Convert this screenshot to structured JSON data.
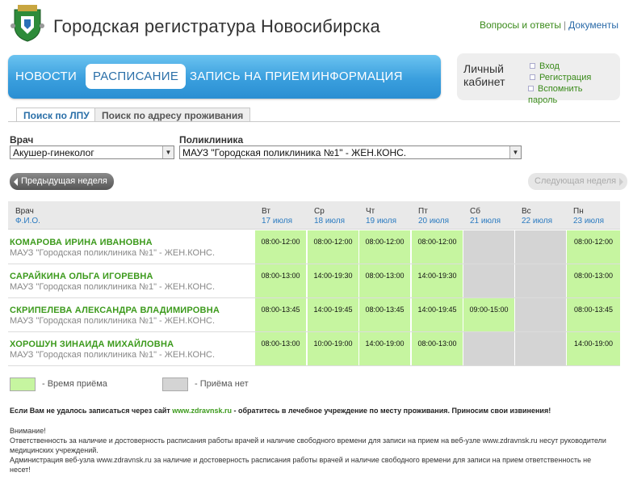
{
  "header": {
    "title": "Городская регистратура Новосибирска",
    "faq_link": "Вопросы и ответы",
    "separator": "|",
    "docs_link": "Документы"
  },
  "nav": {
    "items": [
      {
        "label": "НОВОСТИ"
      },
      {
        "label": "РАСПИСАНИЕ"
      },
      {
        "label": "ЗАПИСЬ НА ПРИЕМ"
      },
      {
        "label": "ИНФОРМАЦИЯ"
      }
    ],
    "active_index": 1
  },
  "cabinet": {
    "title": "Личный кабинет",
    "login": "Вход",
    "register": "Регистрация",
    "remember": "Вспомнить пароль"
  },
  "tabs": {
    "by_clinic": "Поиск по ЛПУ",
    "by_address": "Поиск по адресу проживания"
  },
  "filters": {
    "doctor_label": "Врач",
    "doctor_value": "Акушер-гинеколог",
    "clinic_label": "Поликлиника",
    "clinic_value": "МАУЗ \"Городская поликлиника №1\" - ЖЕН.КОНС."
  },
  "week_nav": {
    "prev": "Предыдущая неделя",
    "next": "Следующая неделя"
  },
  "table": {
    "doctor_header": "Врач",
    "doctor_subheader": "Ф.И.О.",
    "days": [
      {
        "name": "Вт",
        "date": "17 июля"
      },
      {
        "name": "Ср",
        "date": "18 июля"
      },
      {
        "name": "Чт",
        "date": "19 июля"
      },
      {
        "name": "Пт",
        "date": "20 июля"
      },
      {
        "name": "Сб",
        "date": "21 июля"
      },
      {
        "name": "Вс",
        "date": "22 июля"
      },
      {
        "name": "Пн",
        "date": "23 июля"
      }
    ],
    "rows": [
      {
        "name": "КОМАРОВА ИРИНА ИВАНОВНА",
        "place": "МАУЗ \"Городская поликлиника №1\" - ЖЕН.КОНС.",
        "slots": [
          "08:00-12:00",
          "08:00-12:00",
          "08:00-12:00",
          "08:00-12:00",
          "",
          "",
          "08:00-12:00"
        ]
      },
      {
        "name": "САРАЙКИНА ОЛЬГА ИГОРЕВНА",
        "place": "МАУЗ \"Городская поликлиника №1\" - ЖЕН.КОНС.",
        "slots": [
          "08:00-13:00",
          "14:00-19:30",
          "08:00-13:00",
          "14:00-19:30",
          "",
          "",
          "08:00-13:00"
        ]
      },
      {
        "name": "СКРИПЕЛЕВА АЛЕКСАНДРА ВЛАДИМИРОВНА",
        "place": "МАУЗ \"Городская поликлиника №1\" - ЖЕН.КОНС.",
        "slots": [
          "08:00-13:45",
          "14:00-19:45",
          "08:00-13:45",
          "14:00-19:45",
          "09:00-15:00",
          "",
          "08:00-13:45"
        ]
      },
      {
        "name": "ХОРОШУН ЗИНАИДА МИХАЙЛОВНА",
        "place": "МАУЗ \"Городская поликлиника №1\" - ЖЕН.КОНС.",
        "slots": [
          "08:00-13:00",
          "10:00-19:00",
          "14:00-19:00",
          "08:00-13:00",
          "",
          "",
          "14:00-19:00"
        ]
      }
    ]
  },
  "legend": {
    "reception": "- Время приёма",
    "no_reception": "- Приёма нет"
  },
  "notice": {
    "before": "Если Вам не удалось записаться через сайт ",
    "link": "www.zdravnsk.ru",
    "after": " - обратитесь в лечебное учреждение по месту проживания. Приносим свои извинения!"
  },
  "warning": {
    "title": "Внимание!",
    "line1": "Ответственность за наличие и достоверность расписания работы врачей и наличие свободного времени для записи на прием на веб-узле www.zdravnsk.ru несут руководители медицинских учреждений.",
    "line2": "Администрация веб-узла www.zdravnsk.ru за наличие и достоверность расписания работы врачей и наличие свободного времени для записи на прием ответственность не несет!"
  },
  "colors": {
    "green_slot": "#c6f5a0",
    "gray_slot": "#d4d4d4",
    "nav_blue": "#3a9fde",
    "name_green": "#3c9a1c"
  }
}
